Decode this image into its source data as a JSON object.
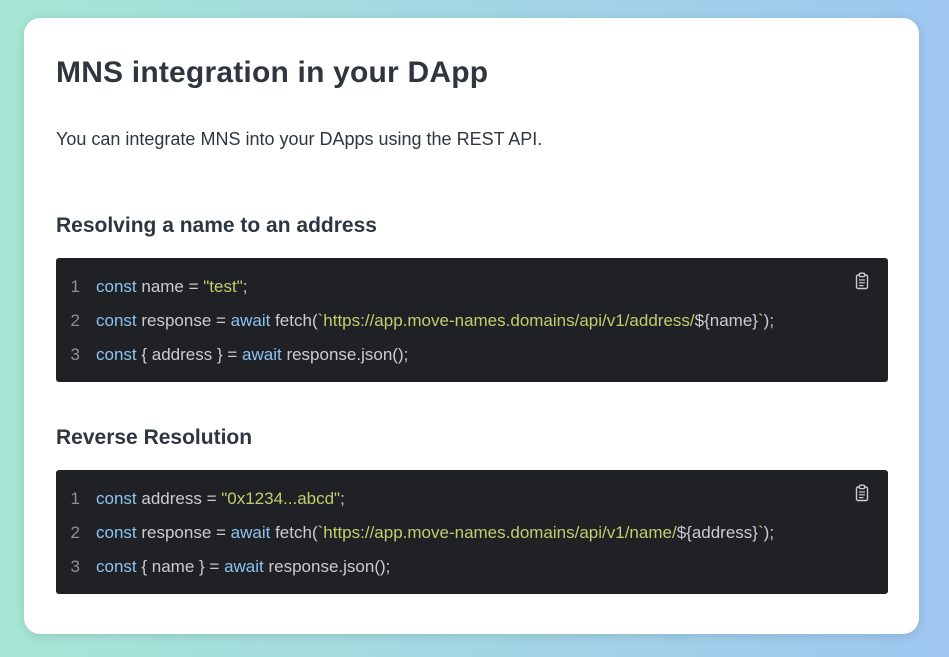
{
  "page": {
    "title": "MNS integration in your DApp",
    "intro": "You can integrate MNS into your DApps using the REST API."
  },
  "sections": [
    {
      "title": "Resolving a name to an address",
      "code": [
        {
          "number": "1",
          "tokens": [
            {
              "text": "const",
              "type": "keyword"
            },
            {
              "text": " name = ",
              "type": "plain"
            },
            {
              "text": "\"test\"",
              "type": "string"
            },
            {
              "text": ";",
              "type": "plain"
            }
          ]
        },
        {
          "number": "2",
          "tokens": [
            {
              "text": "const",
              "type": "keyword"
            },
            {
              "text": " response = ",
              "type": "plain"
            },
            {
              "text": "await",
              "type": "keyword"
            },
            {
              "text": " fetch(",
              "type": "plain"
            },
            {
              "text": "`https://app.move-names.domains/api/v1/address/",
              "type": "string"
            },
            {
              "text": "${name}",
              "type": "plain"
            },
            {
              "text": "`",
              "type": "string"
            },
            {
              "text": ");",
              "type": "plain"
            }
          ]
        },
        {
          "number": "3",
          "tokens": [
            {
              "text": "const",
              "type": "keyword"
            },
            {
              "text": " { address } = ",
              "type": "plain"
            },
            {
              "text": "await",
              "type": "keyword"
            },
            {
              "text": " response.json();",
              "type": "plain"
            }
          ]
        }
      ]
    },
    {
      "title": "Reverse Resolution",
      "code": [
        {
          "number": "1",
          "tokens": [
            {
              "text": "const",
              "type": "keyword"
            },
            {
              "text": " address = ",
              "type": "plain"
            },
            {
              "text": "\"0x1234...abcd\"",
              "type": "string"
            },
            {
              "text": ";",
              "type": "plain"
            }
          ]
        },
        {
          "number": "2",
          "tokens": [
            {
              "text": "const",
              "type": "keyword"
            },
            {
              "text": " response = ",
              "type": "plain"
            },
            {
              "text": "await",
              "type": "keyword"
            },
            {
              "text": " fetch(",
              "type": "plain"
            },
            {
              "text": "`https://app.move-names.domains/api/v1/name/",
              "type": "string"
            },
            {
              "text": "${address}",
              "type": "plain"
            },
            {
              "text": "`",
              "type": "string"
            },
            {
              "text": ");",
              "type": "plain"
            }
          ]
        },
        {
          "number": "3",
          "tokens": [
            {
              "text": "const",
              "type": "keyword"
            },
            {
              "text": " { name } = ",
              "type": "plain"
            },
            {
              "text": "await",
              "type": "keyword"
            },
            {
              "text": " response.json();",
              "type": "plain"
            }
          ]
        }
      ]
    }
  ],
  "icons": {
    "copy": "clipboard-icon"
  },
  "colors": {
    "code_background": "#1f2124",
    "keyword": "#8cc3f0",
    "string": "#c3cc6f",
    "plain": "#c9ccd1",
    "line_number": "#8d9199",
    "heading": "#2f3640"
  }
}
